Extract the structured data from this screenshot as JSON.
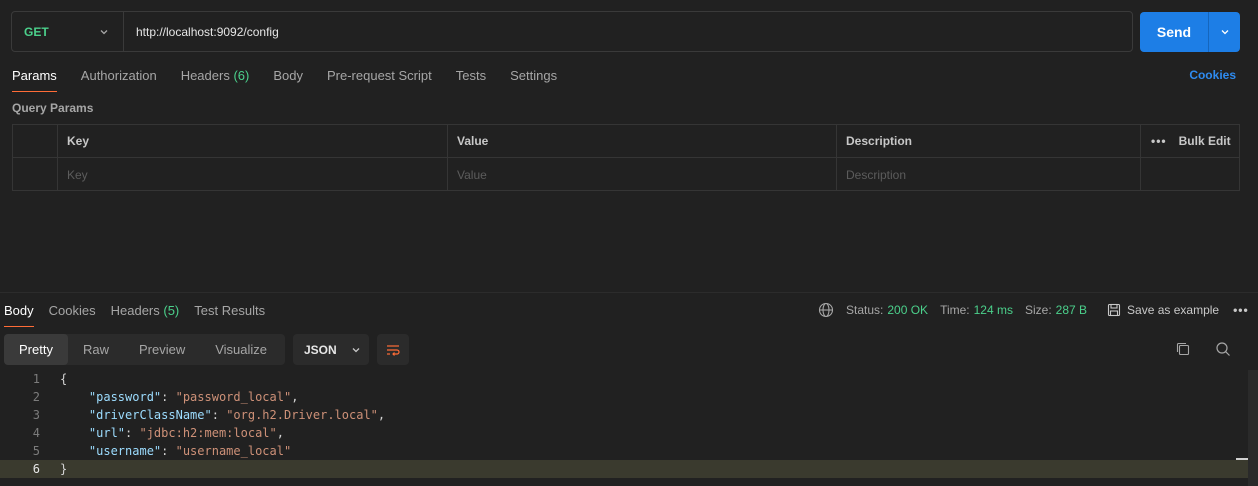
{
  "request": {
    "method": "GET",
    "url": "http://localhost:9092/config",
    "send_label": "Send"
  },
  "request_tabs": [
    {
      "label": "Params",
      "count": ""
    },
    {
      "label": "Authorization",
      "count": ""
    },
    {
      "label": "Headers",
      "count": "(6)"
    },
    {
      "label": "Body",
      "count": ""
    },
    {
      "label": "Pre-request Script",
      "count": ""
    },
    {
      "label": "Tests",
      "count": ""
    },
    {
      "label": "Settings",
      "count": ""
    }
  ],
  "cookies_link": "Cookies",
  "query_params": {
    "title": "Query Params",
    "headers": {
      "key": "Key",
      "value": "Value",
      "description": "Description",
      "bulk_edit": "Bulk Edit"
    },
    "placeholders": {
      "key": "Key",
      "value": "Value",
      "description": "Description"
    }
  },
  "response": {
    "tabs": [
      {
        "label": "Body",
        "count": ""
      },
      {
        "label": "Cookies",
        "count": ""
      },
      {
        "label": "Headers",
        "count": "(5)"
      },
      {
        "label": "Test Results",
        "count": ""
      }
    ],
    "status_label": "Status:",
    "status_value": "200 OK",
    "time_label": "Time:",
    "time_value": "124 ms",
    "size_label": "Size:",
    "size_value": "287 B",
    "save_example": "Save as example",
    "views": [
      "Pretty",
      "Raw",
      "Preview",
      "Visualize"
    ],
    "format": "JSON",
    "body_lines": [
      {
        "n": "1",
        "parts": [
          [
            "p",
            "{"
          ]
        ]
      },
      {
        "n": "2",
        "parts": [
          [
            "p",
            "    "
          ],
          [
            "k",
            "\"password\""
          ],
          [
            "p",
            ": "
          ],
          [
            "s",
            "\"password_local\""
          ],
          [
            "p",
            ","
          ]
        ]
      },
      {
        "n": "3",
        "parts": [
          [
            "p",
            "    "
          ],
          [
            "k",
            "\"driverClassName\""
          ],
          [
            "p",
            ": "
          ],
          [
            "s",
            "\"org.h2.Driver.local\""
          ],
          [
            "p",
            ","
          ]
        ]
      },
      {
        "n": "4",
        "parts": [
          [
            "p",
            "    "
          ],
          [
            "k",
            "\"url\""
          ],
          [
            "p",
            ": "
          ],
          [
            "s",
            "\"jdbc:h2:mem:local\""
          ],
          [
            "p",
            ","
          ]
        ]
      },
      {
        "n": "5",
        "parts": [
          [
            "p",
            "    "
          ],
          [
            "k",
            "\"username\""
          ],
          [
            "p",
            ": "
          ],
          [
            "s",
            "\"username_local\""
          ]
        ]
      },
      {
        "n": "6",
        "parts": [
          [
            "p",
            "}"
          ]
        ]
      }
    ]
  },
  "colors": {
    "accent": "#ff6c37",
    "send": "#1d7ee6",
    "ok": "#4bd08b",
    "link": "#2e8bf0"
  }
}
